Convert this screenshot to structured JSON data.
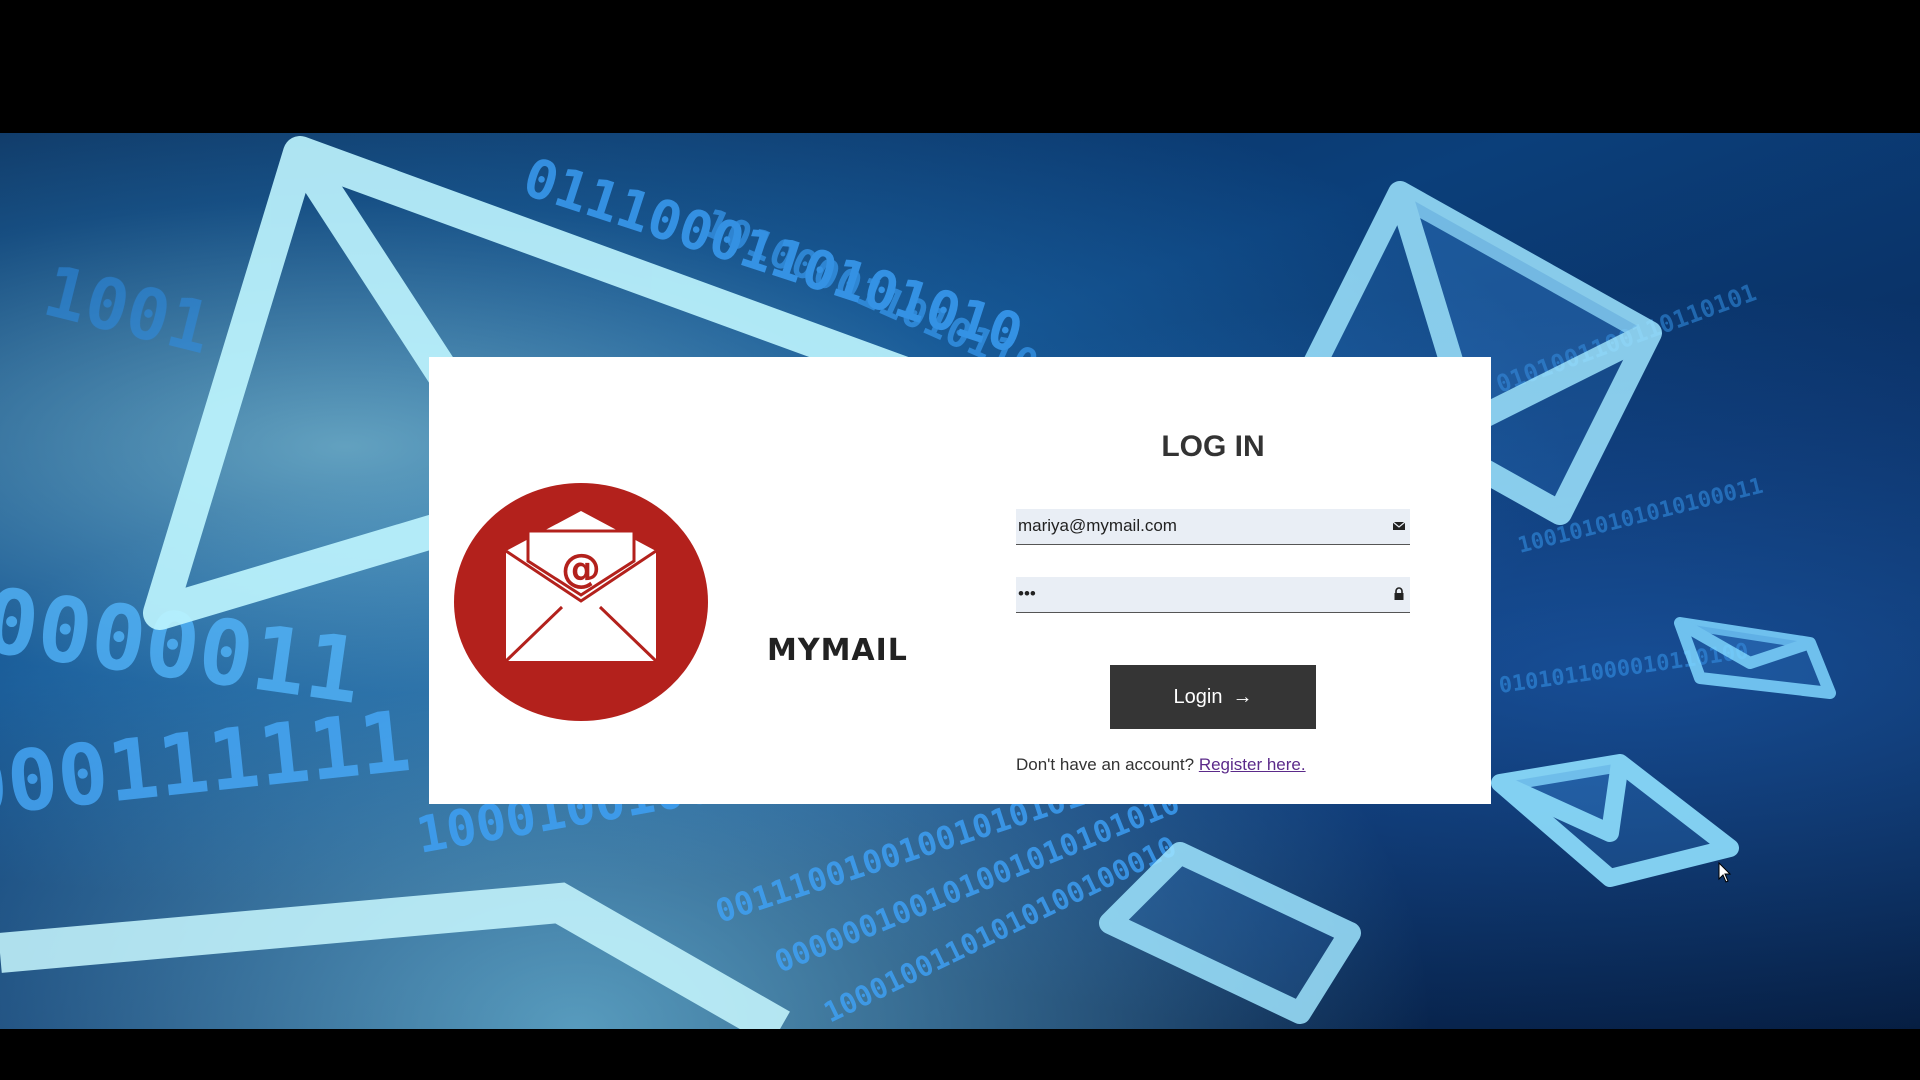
{
  "brand": {
    "name": "MYMAIL",
    "logo_icon": "open-envelope-at-icon",
    "logo_color": "#b3211c"
  },
  "login": {
    "title": "LOG IN",
    "email_value": "mariya@mymail.com",
    "email_icon": "envelope-icon",
    "password_value": "•••",
    "password_icon": "lock-icon",
    "button_label": "Login",
    "button_icon": "arrow-right-icon",
    "button_color": "#353535",
    "register_prompt": "Don't have an account?",
    "register_link": "Register here."
  }
}
